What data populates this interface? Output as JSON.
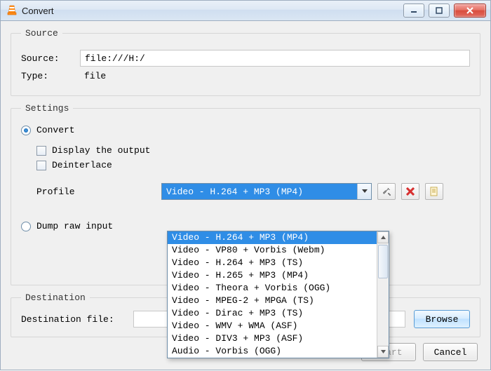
{
  "window": {
    "title": "Convert"
  },
  "source_group": {
    "legend": "Source",
    "source_label": "Source:",
    "source_value": "file:///H:/",
    "type_label": "Type:",
    "type_value": "file"
  },
  "settings_group": {
    "legend": "Settings",
    "convert_label": "Convert",
    "display_output_label": "Display the output",
    "deinterlace_label": "Deinterlace",
    "profile_label": "Profile",
    "profile_selected": "Video - H.264 + MP3 (MP4)",
    "profile_options": [
      "Video - H.264 + MP3 (MP4)",
      "Video - VP80 + Vorbis (Webm)",
      "Video - H.264 + MP3 (TS)",
      "Video - H.265 + MP3 (MP4)",
      "Video - Theora + Vorbis (OGG)",
      "Video - MPEG-2 + MPGA (TS)",
      "Video - Dirac + MP3 (TS)",
      "Video - WMV + WMA (ASF)",
      "Video - DIV3 + MP3 (ASF)",
      "Audio - Vorbis (OGG)"
    ],
    "dump_raw_label": "Dump raw input"
  },
  "destination_group": {
    "legend": "Destination",
    "dest_label": "Destination file:",
    "dest_value": "",
    "browse_label": "Browse"
  },
  "footer": {
    "start_label": "Start",
    "cancel_label": "Cancel"
  }
}
